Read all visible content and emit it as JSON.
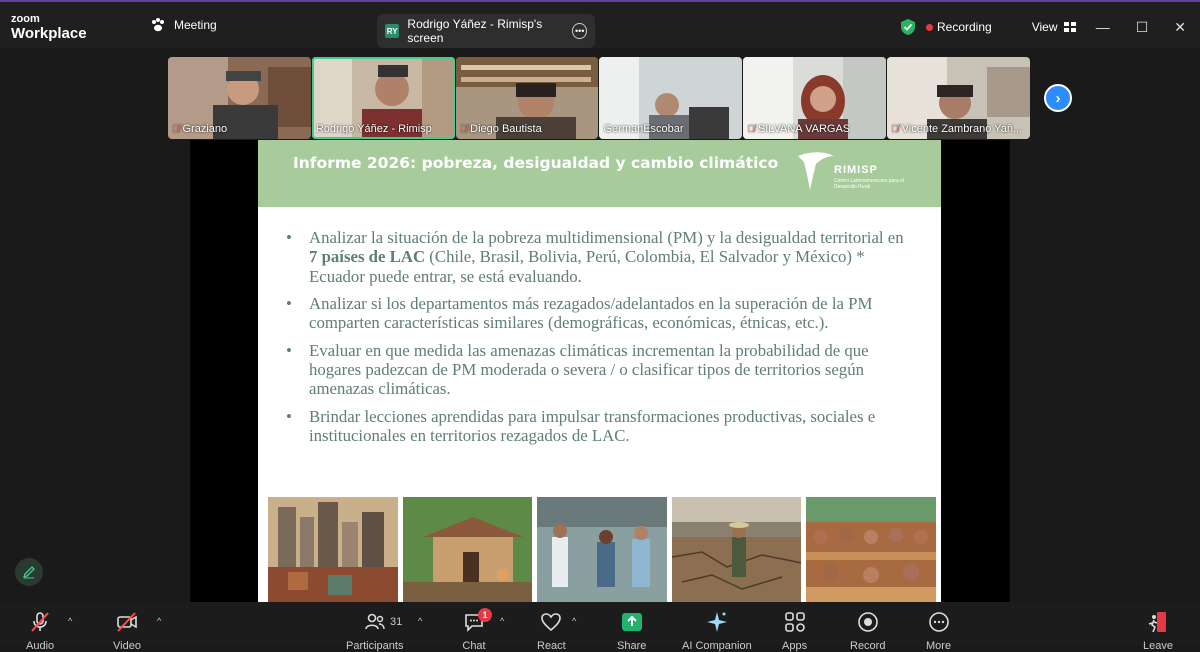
{
  "app": {
    "brand_small": "zoom",
    "brand_big": "Workplace"
  },
  "header": {
    "meeting_label": "Meeting",
    "screen_share_badge": "RY",
    "screen_share_label": "Rodrigo Yáñez - Rimisp's screen",
    "recording_label": "Recording",
    "view_label": "View",
    "colors": {
      "recording_dot": "#e63946",
      "accent_green": "#3ecf8e",
      "brand_blue": "#2d8cff"
    }
  },
  "participants": [
    {
      "name": "Graziano",
      "muted": true
    },
    {
      "name": "Rodrigo Yáñez - Rimisp",
      "muted": false,
      "active": true
    },
    {
      "name": "Diego Bautista",
      "muted": true
    },
    {
      "name": "GermanEscobar",
      "muted": false
    },
    {
      "name": "SILVANA VARGAS",
      "muted": true
    },
    {
      "name": "Vicente Zambrano Yañ...",
      "muted": true
    }
  ],
  "slide": {
    "title": "Informe 2026: pobreza, desigualdad y cambio climático",
    "logo_word": "RIMISP",
    "logo_sub": "Centro Latinoamericano para el Desarrollo Rural",
    "bullets": [
      {
        "pre": "Analizar la situación de la pobreza multidimensional (PM) y la desigualdad territorial en ",
        "bold": "7 países de LAC",
        "post": " (Chile, Brasil, Bolivia, Perú, Colombia, El Salvador y México) * Ecuador puede entrar, se está evaluando."
      },
      {
        "pre": "Analizar si los departamentos más rezagados/adelantados en la superación de la PM comparten características similares (demográficas, económicas, étnicas, etc.).",
        "bold": "",
        "post": ""
      },
      {
        "pre": "Evaluar en que medida las amenazas climáticas incrementan la probabilidad de que hogares padezcan de PM moderada o severa / o clasificar tipos de territorios según amenazas climáticas.",
        "bold": "",
        "post": ""
      },
      {
        "pre": "Brindar lecciones aprendidas para impulsar transformaciones productivas, sociales e institucionales en territorios rezagados de LAC.",
        "bold": "",
        "post": ""
      }
    ]
  },
  "toolbar": {
    "audio": "Audio",
    "video": "Video",
    "participants": "Participants",
    "participants_count": "31",
    "chat": "Chat",
    "chat_badge": "1",
    "react": "React",
    "share": "Share",
    "ai_companion": "AI Companion",
    "apps": "Apps",
    "record": "Record",
    "more": "More",
    "leave": "Leave"
  }
}
